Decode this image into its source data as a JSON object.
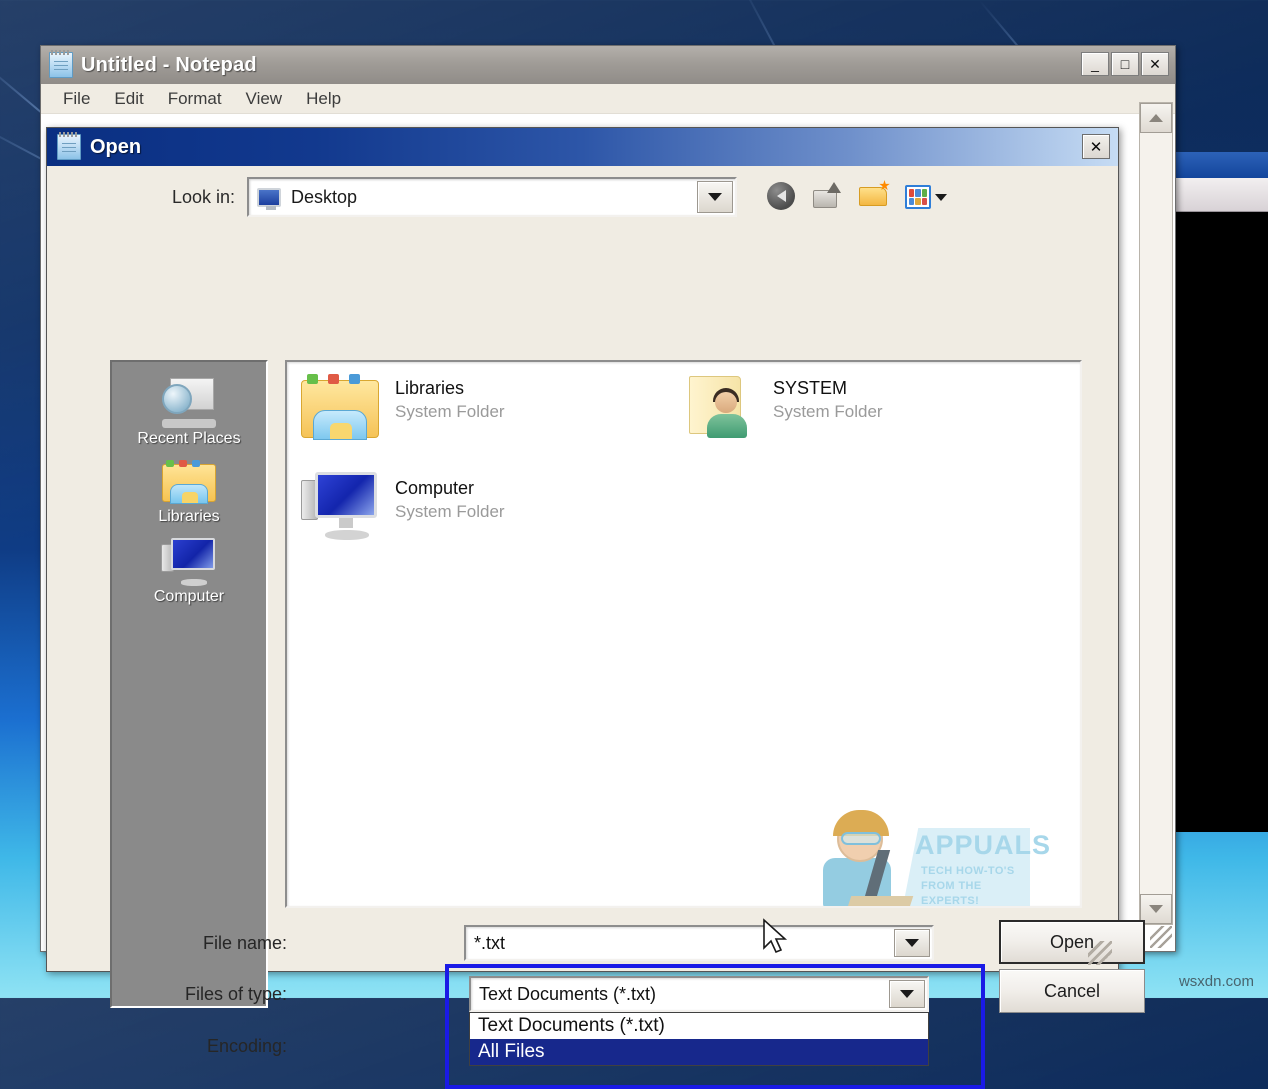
{
  "desktop": {
    "site_watermark": "wsxdn.com"
  },
  "notepad": {
    "title": "Untitled - Notepad",
    "icon": "notepad-icon",
    "menu": [
      "File",
      "Edit",
      "Format",
      "View",
      "Help"
    ],
    "window_buttons": {
      "minimize": "_",
      "maximize": "□",
      "close": "✕"
    }
  },
  "dialog": {
    "title": "Open",
    "icon": "notepad-icon",
    "close_label": "✕",
    "lookin": {
      "label": "Look in:",
      "value": "Desktop",
      "icon": "desktop-monitor-icon"
    },
    "toolbar": [
      {
        "name": "back-button",
        "icon": "back-arrow-icon"
      },
      {
        "name": "up-one-level-button",
        "icon": "up-folder-icon"
      },
      {
        "name": "new-folder-button",
        "icon": "new-folder-icon"
      },
      {
        "name": "views-button",
        "icon": "views-grid-icon"
      }
    ],
    "places": [
      {
        "label": "Recent Places",
        "icon": "recent-places-icon"
      },
      {
        "label": "Libraries",
        "icon": "libraries-folder-icon"
      },
      {
        "label": "Computer",
        "icon": "computer-monitor-icon"
      }
    ],
    "files": [
      {
        "name": "Libraries",
        "type": "System Folder",
        "icon": "libraries-folder-icon"
      },
      {
        "name": "SYSTEM",
        "type": "System Folder",
        "icon": "user-folder-icon"
      },
      {
        "name": "Computer",
        "type": "System Folder",
        "icon": "computer-monitor-icon"
      }
    ],
    "form": {
      "filename_label": "File name:",
      "filename_value": "*.txt",
      "filename_placeholder": "",
      "filetype_label": "Files of type:",
      "filetype_value": "Text Documents (*.txt)",
      "encoding_label": "Encoding:"
    },
    "filetype_options": [
      {
        "label": "Text Documents (*.txt)",
        "selected": false
      },
      {
        "label": "All Files",
        "selected": true
      }
    ],
    "buttons": {
      "open": "Open",
      "cancel": "Cancel"
    }
  },
  "watermark": {
    "title": "APPUALS",
    "subtitle": "TECH HOW-TO'S FROM THE EXPERTS!"
  },
  "colors": {
    "highlight": "#17288c",
    "focus_box": "#1a1ae6",
    "title_gradient_start": "#0a2f82",
    "places_bg": "#8a8a8a"
  }
}
